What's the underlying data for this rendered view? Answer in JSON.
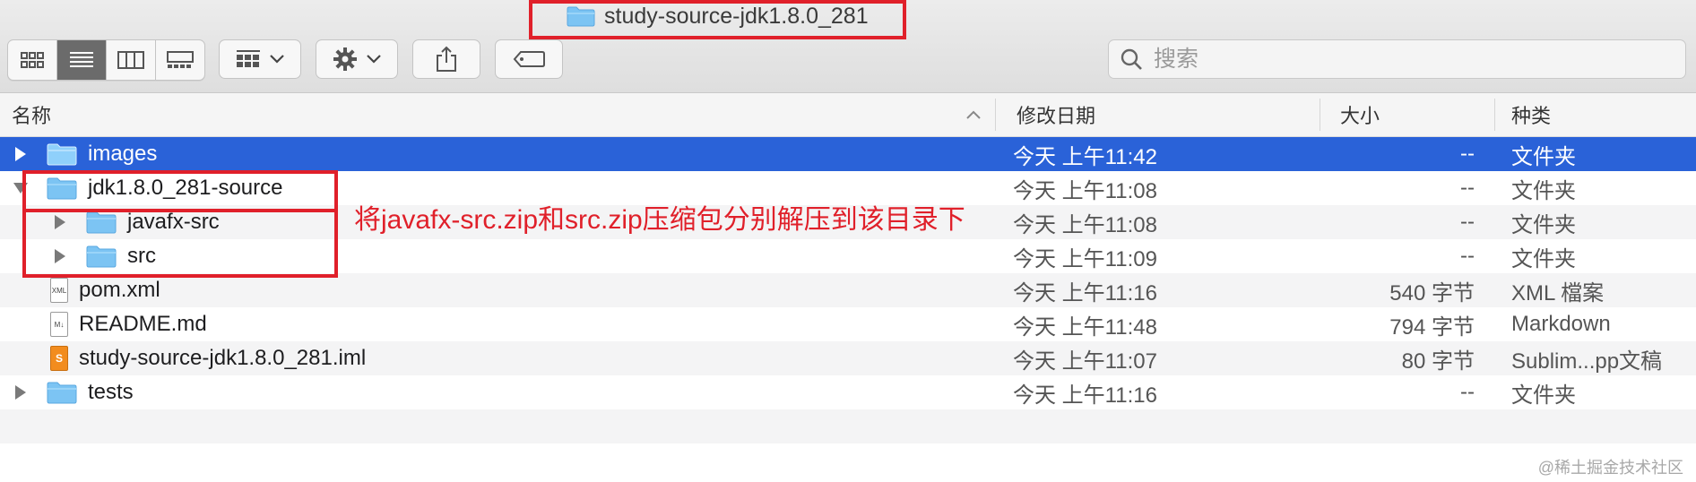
{
  "window": {
    "title": "study-source-jdk1.8.0_281"
  },
  "toolbar": {
    "view_buttons": [
      {
        "name": "icon-view-button",
        "icon": "grid-icon"
      },
      {
        "name": "list-view-button",
        "icon": "list-icon",
        "active": true
      },
      {
        "name": "column-view-button",
        "icon": "columns-icon"
      },
      {
        "name": "gallery-view-button",
        "icon": "gallery-icon"
      }
    ],
    "group_button_icon": "group-grid-icon",
    "action_button_icon": "gear-icon",
    "share_button_icon": "share-icon",
    "tag_button_icon": "tag-icon"
  },
  "search": {
    "placeholder": "搜索",
    "value": ""
  },
  "columns": {
    "name": "名称",
    "date": "修改日期",
    "size": "大小",
    "kind": "种类"
  },
  "files": [
    {
      "name": "images",
      "date": "今天 上午11:42",
      "size": "--",
      "kind": "文件夹",
      "type": "folder",
      "level": 0,
      "disclosure": "collapsed",
      "selected": true
    },
    {
      "name": "jdk1.8.0_281-source",
      "date": "今天 上午11:08",
      "size": "--",
      "kind": "文件夹",
      "type": "folder",
      "level": 0,
      "disclosure": "expanded"
    },
    {
      "name": "javafx-src",
      "date": "今天 上午11:08",
      "size": "--",
      "kind": "文件夹",
      "type": "folder",
      "level": 1,
      "disclosure": "collapsed"
    },
    {
      "name": "src",
      "date": "今天 上午11:09",
      "size": "--",
      "kind": "文件夹",
      "type": "folder",
      "level": 1,
      "disclosure": "collapsed"
    },
    {
      "name": "pom.xml",
      "date": "今天 上午11:16",
      "size": "540 字节",
      "kind": "XML 檔案",
      "type": "file",
      "icon_label": "XML",
      "level": 0
    },
    {
      "name": "README.md",
      "date": "今天 上午11:48",
      "size": "794 字节",
      "kind": "Markdown",
      "type": "file",
      "icon_label": "M↓",
      "level": 0
    },
    {
      "name": "study-source-jdk1.8.0_281.iml",
      "date": "今天 上午11:07",
      "size": "80 字节",
      "kind": "Sublim...pp文稿",
      "type": "file",
      "icon_label": "S",
      "level": 0
    },
    {
      "name": "tests",
      "date": "今天 上午11:16",
      "size": "--",
      "kind": "文件夹",
      "type": "folder",
      "level": 0,
      "disclosure": "collapsed"
    }
  ],
  "annotation": "将javafx-src.zip和src.zip压缩包分别解压到该目录下",
  "watermark": "@稀土掘金技术社区",
  "colors": {
    "selection": "#2a62d8",
    "folder": "#7cc4f3",
    "highlight": "#e0202a"
  }
}
